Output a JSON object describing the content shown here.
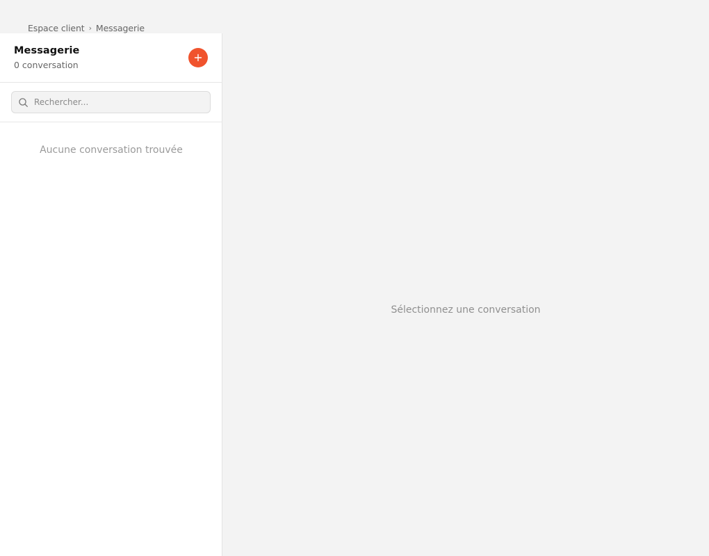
{
  "breadcrumb": {
    "items": [
      {
        "label": "Espace client"
      },
      {
        "label": "Messagerie"
      }
    ],
    "separator": "›"
  },
  "sidebar": {
    "title": "Messagerie",
    "count_label": "0 conversation",
    "new_button": {
      "icon": "plus-icon",
      "color": "#f0532d"
    },
    "search": {
      "placeholder": "Rechercher...",
      "value": "",
      "icon": "search-icon"
    },
    "empty_text": "Aucune conversation trouvée"
  },
  "main": {
    "empty_text": "Sélectionnez une conversation"
  },
  "colors": {
    "accent": "#f0532d",
    "background": "#f3f3f3",
    "panel": "#ffffff"
  }
}
